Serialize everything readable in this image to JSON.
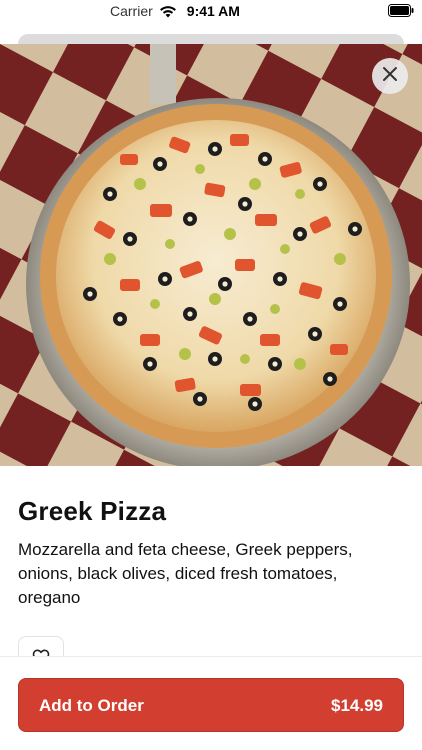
{
  "status_bar": {
    "carrier": "Carrier",
    "time": "9:41 AM",
    "wifi_icon": "wifi-icon",
    "battery_icon": "battery-icon"
  },
  "hero": {
    "image": "pizza-photo",
    "close_icon": "close-icon"
  },
  "item": {
    "title": "Greek Pizza",
    "description": "Mozzarella and feta cheese, Greek peppers, onions, black olives, diced fresh tomatoes, oregano",
    "favorite_icon": "heart-icon"
  },
  "order": {
    "add_label": "Add to Order",
    "price": "$14.99"
  },
  "colors": {
    "accent": "#d23f31",
    "text": "#111111",
    "background": "#ffffff"
  }
}
